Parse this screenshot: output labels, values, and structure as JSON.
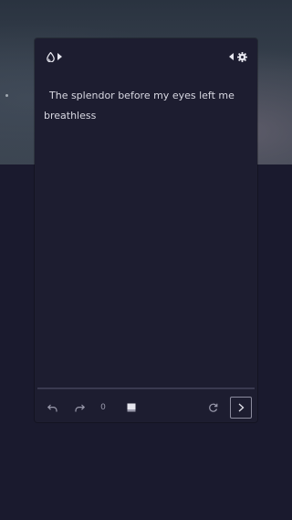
{
  "editor": {
    "text": "The splendor before my eyes left me breathless"
  },
  "toolbar": {
    "char_count": "0"
  },
  "icons": {
    "top_left": [
      "drop-icon",
      "play-right-icon"
    ],
    "top_right": [
      "play-left-icon",
      "gear-icon"
    ],
    "bottom_left": [
      "undo-icon",
      "redo-icon",
      "image-icon"
    ],
    "bottom_right": [
      "refresh-icon",
      "send-chevron-icon"
    ]
  },
  "colors": {
    "panel": "#1d1d30",
    "background_dark": "#1a1a2e",
    "text": "#d8d8e2"
  }
}
